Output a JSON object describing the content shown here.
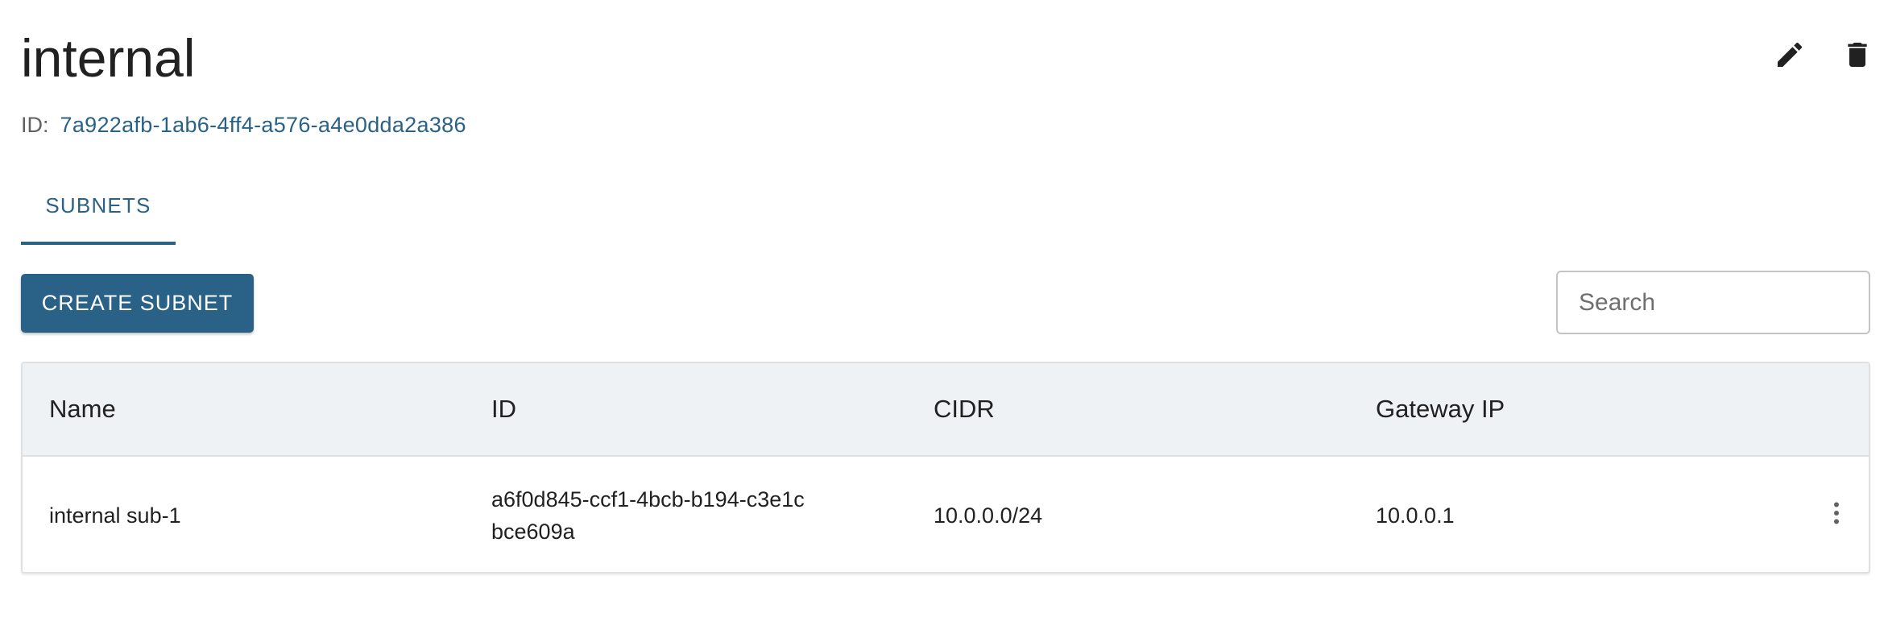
{
  "header": {
    "title": "internal",
    "id_label": "ID:",
    "id_value": "7a922afb-1ab6-4ff4-a576-a4e0dda2a386"
  },
  "icons": {
    "edit": "pencil-icon",
    "delete": "trash-icon",
    "row_menu": "more-vertical-icon"
  },
  "tabs": [
    {
      "label": "SUBNETS",
      "active": true
    }
  ],
  "toolbar": {
    "create_label": "CREATE SUBNET",
    "search_placeholder": "Search",
    "search_value": ""
  },
  "table": {
    "columns": [
      "Name",
      "ID",
      "CIDR",
      "Gateway IP"
    ],
    "rows": [
      {
        "name": "internal sub-1",
        "id": "a6f0d845-ccf1-4bcb-b194-c3e1cbce609a",
        "cidr": "10.0.0.0/24",
        "gateway_ip": "10.0.0.1"
      }
    ]
  },
  "colors": {
    "accent": "#2a6287",
    "header_bg": "#eff2f5",
    "text": "#212121",
    "muted": "#616161"
  }
}
